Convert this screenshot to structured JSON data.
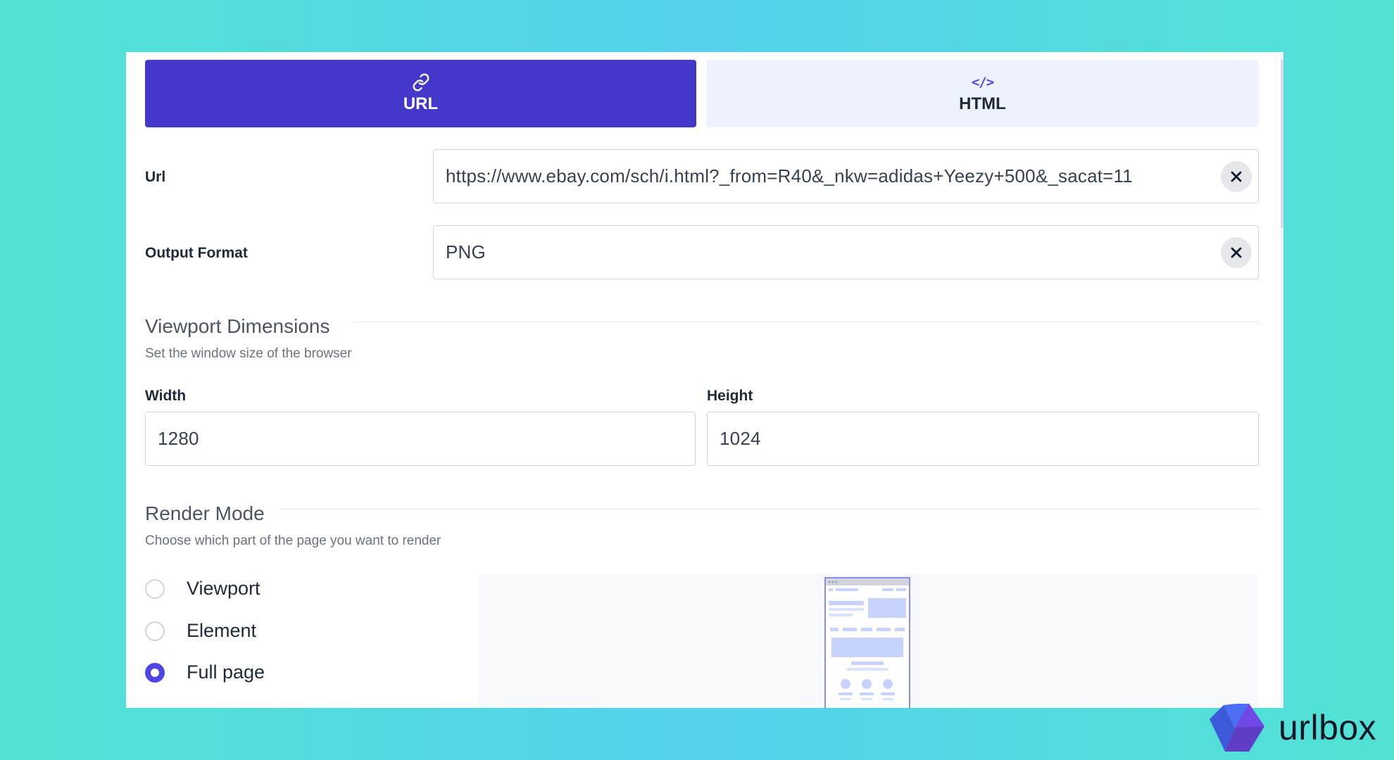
{
  "tabs": [
    {
      "label": "URL",
      "icon": "link-icon",
      "active": true
    },
    {
      "label": "HTML",
      "icon": "code-icon",
      "active": false
    }
  ],
  "html_icon_glyph": "</>",
  "url_field": {
    "label": "Url",
    "value": "https://www.ebay.com/sch/i.html?_from=R40&_nkw=adidas+Yeezy+500&_sacat=11"
  },
  "output_format": {
    "label": "Output Format",
    "value": "PNG"
  },
  "viewport": {
    "title": "Viewport Dimensions",
    "subtitle": "Set the window size of the browser",
    "width_label": "Width",
    "width_value": "1280",
    "height_label": "Height",
    "height_value": "1024"
  },
  "render_mode": {
    "title": "Render Mode",
    "subtitle": "Choose which part of the page you want to render",
    "options": [
      {
        "label": "Viewport",
        "checked": false
      },
      {
        "label": "Element",
        "checked": false
      },
      {
        "label": "Full page",
        "checked": true
      }
    ]
  },
  "brand": {
    "name": "urlbox"
  },
  "colors": {
    "accent": "#4338ca",
    "accent_light": "#eef2ff",
    "radio": "#4f46e5",
    "background": "#56d0ec"
  }
}
